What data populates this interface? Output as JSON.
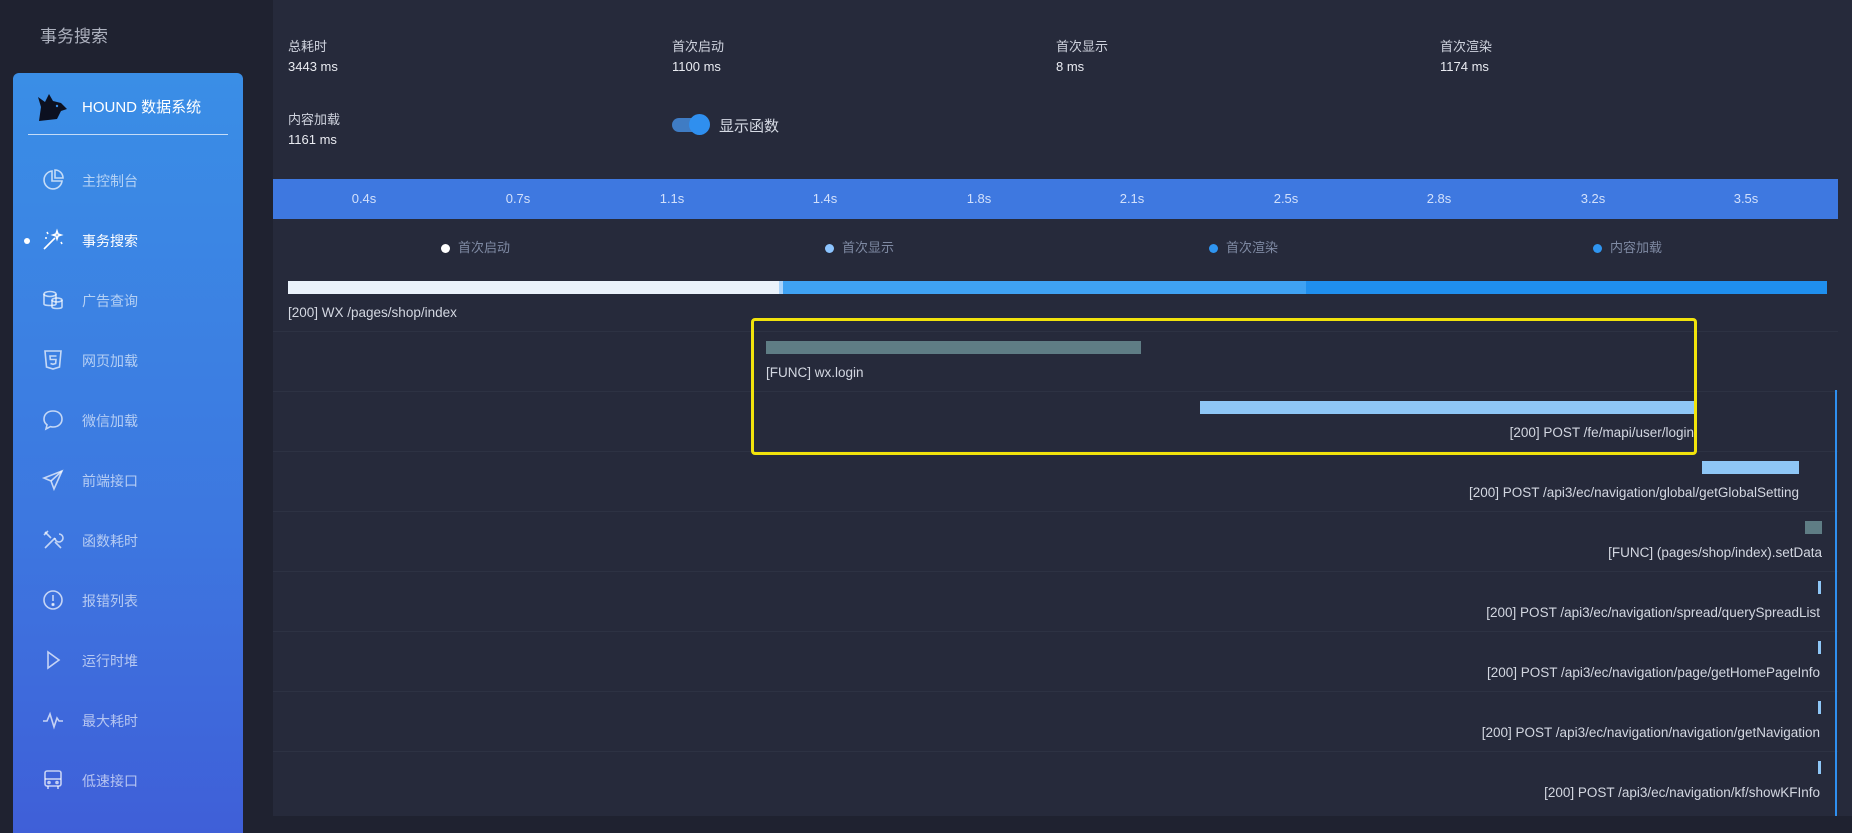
{
  "app_title": "事务搜索",
  "sidebar": {
    "brand": "HOUND 数据系统",
    "items": [
      {
        "label": "主控制台",
        "icon": "pie-chart-icon"
      },
      {
        "label": "事务搜索",
        "icon": "magic-wand-icon",
        "active": true
      },
      {
        "label": "广告查询",
        "icon": "coins-icon"
      },
      {
        "label": "网页加载",
        "icon": "html5-icon"
      },
      {
        "label": "微信加载",
        "icon": "chat-bubble-icon"
      },
      {
        "label": "前端接口",
        "icon": "paper-plane-icon"
      },
      {
        "label": "函数耗时",
        "icon": "tools-icon"
      },
      {
        "label": "报错列表",
        "icon": "alert-circle-icon"
      },
      {
        "label": "运行时堆",
        "icon": "play-icon"
      },
      {
        "label": "最大耗时",
        "icon": "pulse-icon"
      },
      {
        "label": "低速接口",
        "icon": "bus-icon"
      }
    ]
  },
  "stats": [
    {
      "label": "总耗时",
      "value": "3443 ms"
    },
    {
      "label": "首次启动",
      "value": "1100 ms"
    },
    {
      "label": "首次显示",
      "value": "8 ms"
    },
    {
      "label": "首次渲染",
      "value": "1174 ms"
    },
    {
      "label": "内容加载",
      "value": "1161 ms"
    }
  ],
  "toggle": {
    "label": "显示函数",
    "on": true
  },
  "timeline": {
    "ticks": [
      "0.4s",
      "0.7s",
      "1.1s",
      "1.4s",
      "1.8s",
      "2.1s",
      "2.5s",
      "2.8s",
      "3.2s",
      "3.5s"
    ],
    "legend": [
      {
        "label": "首次启动",
        "color": "#ffffff"
      },
      {
        "label": "首次显示",
        "color": "#8cc4ff"
      },
      {
        "label": "首次渲染",
        "color": "#2f95f0"
      },
      {
        "label": "内容加载",
        "color": "#2f95f0"
      }
    ],
    "main_request": "[200] WX /pages/shop/index",
    "rows": [
      {
        "label": "[FUNC] wx.login",
        "color": "#5f7d85"
      },
      {
        "label": "[200] POST /fe/mapi/user/login",
        "color": "#8ec6f6"
      },
      {
        "label": "[200] POST /api3/ec/navigation/global/getGlobalSetting",
        "color": "#8ec6f6"
      },
      {
        "label": "[FUNC] (pages/shop/index).setData",
        "color": "#5f7d85"
      },
      {
        "label": "[200] POST /api3/ec/navigation/spread/querySpreadList",
        "color": "#8ec6f6"
      },
      {
        "label": "[200] POST /api3/ec/navigation/page/getHomePageInfo",
        "color": "#8ec6f6"
      },
      {
        "label": "[200] POST /api3/ec/navigation/navigation/getNavigation",
        "color": "#8ec6f6"
      },
      {
        "label": "[200] POST /api3/ec/navigation/kf/showKFInfo",
        "color": "#8ec6f6"
      }
    ]
  }
}
